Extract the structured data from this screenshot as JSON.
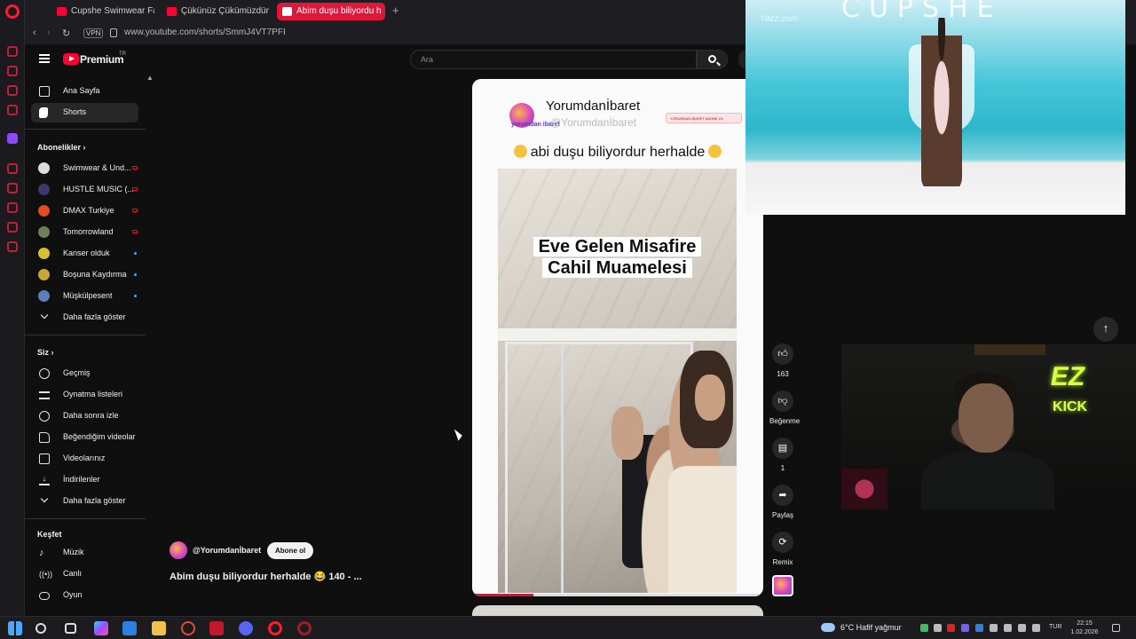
{
  "browser": {
    "tabs": [
      {
        "title": "Cupshe Swimwear Fashio",
        "active": false
      },
      {
        "title": "Çükünüz Çükümüzdür | H",
        "active": false
      },
      {
        "title": "Abim duşu biliyordu h",
        "active": true
      }
    ],
    "vpn_label": "VPN",
    "url": "www.youtube.com/shorts/SmmJ4VT7PFI"
  },
  "masthead": {
    "brand": "Premium",
    "country": "TR",
    "search_placeholder": "Ara"
  },
  "sidebar": {
    "main": [
      {
        "label": "Ana Sayfa",
        "icon": "home-icon"
      },
      {
        "label": "Shorts",
        "icon": "shorts-icon",
        "active": true
      }
    ],
    "subscriptions_heading": "Abonelikler",
    "subscriptions": [
      {
        "label": "Swimwear & Und...",
        "badge": "live",
        "color": "#dddddd"
      },
      {
        "label": "HUSTLE MUSIC (...",
        "badge": "live",
        "color": "#3a3a6a"
      },
      {
        "label": "DMAX Turkiye",
        "badge": "live",
        "color": "#e24b1c"
      },
      {
        "label": "Tomorrowland",
        "badge": "live",
        "color": "#6f7f5a"
      },
      {
        "label": "Kanser olduk",
        "badge": "new",
        "color": "#d6c22b"
      },
      {
        "label": "Boşuna Kaydırma",
        "badge": "new",
        "color": "#caa53a"
      },
      {
        "label": "Müşkülpesent",
        "badge": "new",
        "color": "#5b7fb8"
      }
    ],
    "subscriptions_more": "Daha fazla göster",
    "you_heading": "Siz",
    "you": [
      {
        "label": "Geçmiş",
        "icon": "history-icon"
      },
      {
        "label": "Oynatma listeleri",
        "icon": "playlists-icon"
      },
      {
        "label": "Daha sonra izle",
        "icon": "watch-later-icon"
      },
      {
        "label": "Beğendiğim videolar",
        "icon": "liked-icon"
      },
      {
        "label": "Videolarınız",
        "icon": "your-videos-icon"
      },
      {
        "label": "İndirilenler",
        "icon": "downloads-icon"
      }
    ],
    "you_more": "Daha fazla göster",
    "explore_heading": "Keşfet",
    "explore": [
      {
        "label": "Müzik",
        "icon": "music-icon"
      },
      {
        "label": "Canlı",
        "icon": "live-icon"
      },
      {
        "label": "Oyun",
        "icon": "gaming-icon"
      }
    ]
  },
  "short": {
    "channel_name": "Yorumdanİbaret",
    "channel_handle": "@Yorumdanİbaret",
    "avatar_text": "yorumdan ibaret",
    "caption": "abi duşu biliyordur herhalde",
    "video_overlay_line1": "Eve Gelen Misafire",
    "video_overlay_line2": "Cahil Muamelesi",
    "banner_text": "YORUMDAN İBARET ABONE OL",
    "progress": 0.21
  },
  "actions": {
    "like_count": "163",
    "dislike_label": "Beğenme",
    "comment_count": "1",
    "share_label": "Paylaş",
    "remix_label": "Remix"
  },
  "meta": {
    "handle": "@Yorumdanİbaret",
    "subscribe_label": "Abone ol",
    "title": "Abim duşu biliyordur herhalde 😂 140 -   ..."
  },
  "overlays": {
    "pip_brand": "CUPSHE",
    "pip_watermark": "Yazz.com",
    "cam_logo": "EZ",
    "cam_logo_sub": "KICK"
  },
  "taskbar": {
    "weather": "6°C  Hafif yağmur",
    "lang": "TUR",
    "time": "22:15",
    "date": "1.02.2026"
  },
  "colors": {
    "accent": "#ff0033",
    "opera_red": "#e0163b",
    "background": "#0f0f0f"
  }
}
